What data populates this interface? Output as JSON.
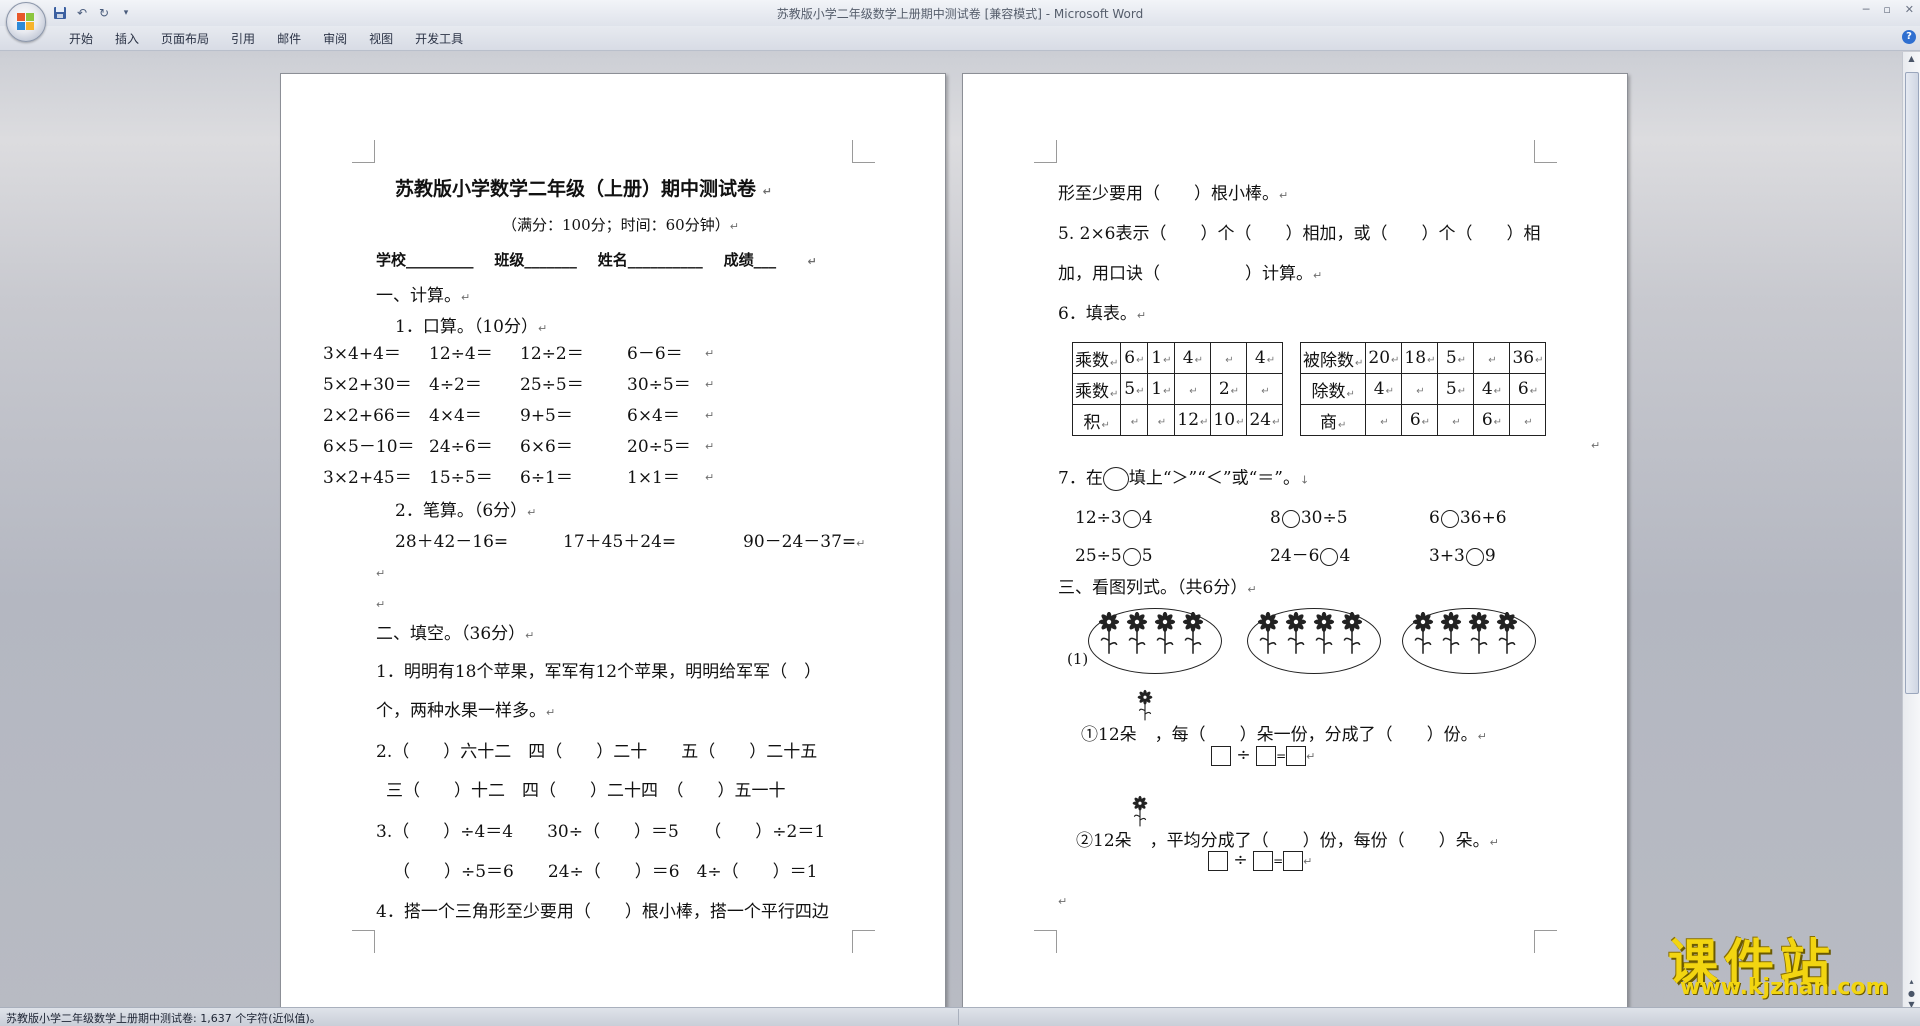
{
  "window": {
    "title": "苏教版小学二年级数学上册期中测试卷 [兼容模式] - Microsoft Word"
  },
  "ribbon": {
    "tabs": [
      "开始",
      "插入",
      "页面布局",
      "引用",
      "邮件",
      "审阅",
      "视图",
      "开发工具"
    ]
  },
  "colors": {
    "app_background": "#c4c7cf",
    "watermark": "#f2d511",
    "help_button": "#2f6fd0"
  },
  "page1": {
    "title": "苏教版小学数学二年级（上册）期中测试卷",
    "subtitle": "（满分：100分；时间：60分钟）",
    "fields": "学校_________    班级_______    姓名__________    成绩___",
    "sec1": "一、计算。",
    "sec1_1": "1．口算。（10分）",
    "oral": [
      [
        "3×4+4＝",
        "12÷4＝",
        "12÷2＝",
        "6－6＝"
      ],
      [
        "5×2+30＝",
        "4÷2＝",
        "25÷5＝",
        "30÷5＝"
      ],
      [
        "2×2+66＝",
        "4×4＝",
        "9+5＝",
        "6×4＝"
      ],
      [
        "6×5－10＝",
        "24÷6＝",
        "6×6＝",
        "20÷5＝"
      ],
      [
        "3×2+45＝",
        "15÷5＝",
        "6÷1＝",
        "1×1＝"
      ]
    ],
    "sec1_2": "2．笔算。（6分）",
    "written": [
      "28＋42－16=",
      "17＋45＋24=",
      "90－24－37="
    ],
    "sec2": "二、填空。（36分）",
    "q1a": "1．明明有18个苹果，军军有12个苹果，明明给军军（　）",
    "q1b": "个，两种水果一样多。",
    "q2a": "2.（　　）六十二　四（　　）二十　　五（　　）二十五",
    "q2b": "三（　　）十二　四（　　）二十四　（　　）五一十",
    "q3a": "3.（　　）÷4＝4　　30÷（　　）＝5　　（　　）÷2＝1",
    "q3b": "（　　）÷5＝6　　24÷（　　）＝6　4÷（　　）＝1",
    "q4": "4．搭一个三角形至少要用（　　）根小棒，搭一个平行四边"
  },
  "page2": {
    "q4b": "形至少要用（　　）根小棒。",
    "q5a": "5. 2×6表示（　　）个（　　）相加，或（　　）个（　　）相",
    "q5b": "加，用口诀（　　　　　）计算。",
    "q6": "6．填表。",
    "table1": [
      [
        "乘数",
        "6",
        "1",
        "4",
        "",
        "4"
      ],
      [
        "乘数",
        "5",
        "1",
        "",
        "2",
        ""
      ],
      [
        "积",
        "",
        "",
        "12",
        "10",
        "24"
      ]
    ],
    "table2": [
      [
        "被除数",
        "20",
        "18",
        "5",
        "",
        "36"
      ],
      [
        "除数",
        "4",
        "",
        "5",
        "4",
        "6"
      ],
      [
        "商",
        "",
        "6",
        "",
        "6",
        ""
      ]
    ],
    "q7_pre": "7．在",
    "q7_post": "填上“＞”“＜”或“＝”。",
    "compare": [
      [
        "12÷3",
        "4",
        "8",
        "30÷5",
        "6",
        "36+6"
      ],
      [
        "25÷5",
        "5",
        "24－6",
        "4",
        "3+3",
        "9"
      ]
    ],
    "sec3": "三、看图列式。（共6分）",
    "pic_label": "(1)",
    "p1": "①12朵",
    "p1_rest": "，每（　　）朵一份，分成了（　　）份。",
    "p2": "②12朵",
    "p2_rest": "，平均分成了（　　）份，每份（　　）朵。",
    "div": "÷",
    "eq": "="
  },
  "statusbar": {
    "text": "苏教版小学二年级数学上册期中测试卷: 1,637 个字符(近似值)。"
  },
  "watermark": {
    "cn": "课件站",
    "url": "www.kjzhan.com"
  }
}
